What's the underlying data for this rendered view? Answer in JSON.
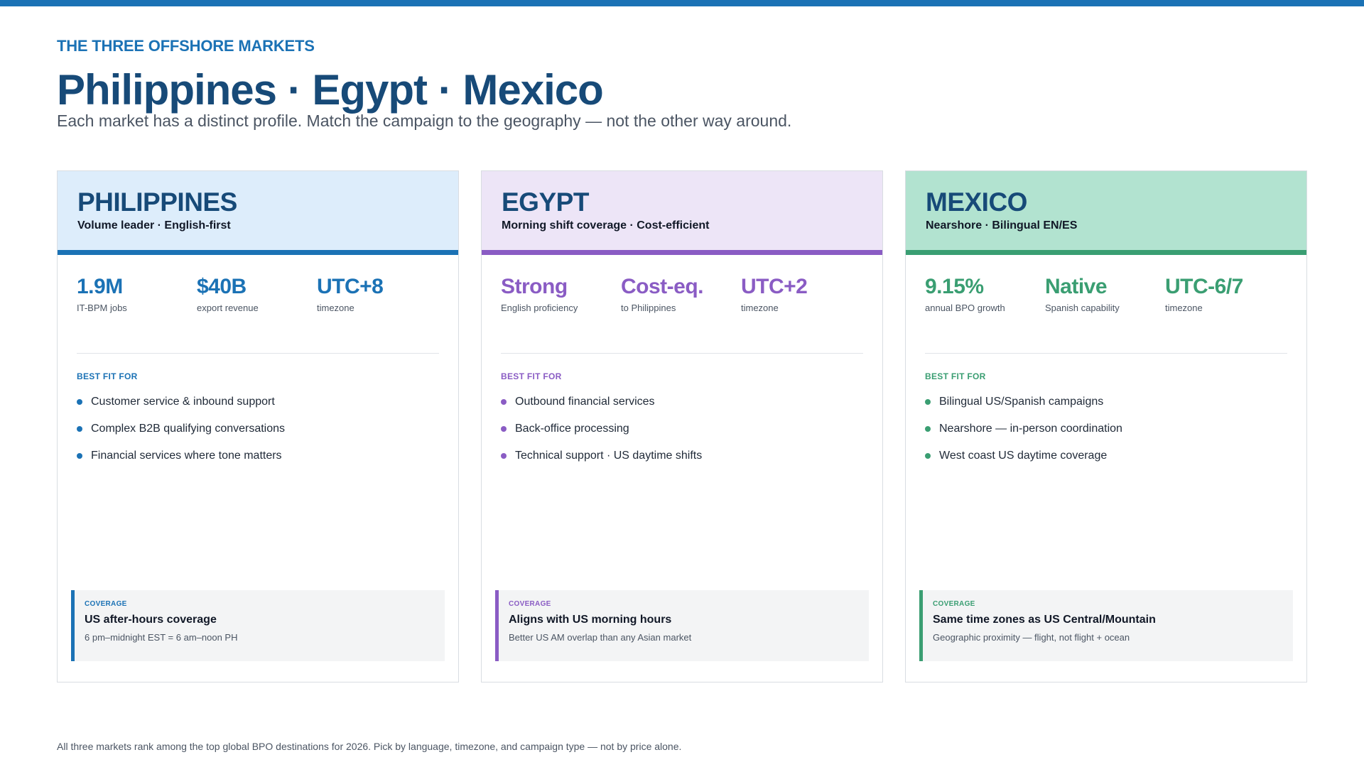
{
  "eyebrow": "THE THREE OFFSHORE MARKETS",
  "title": "Philippines · Egypt · Mexico",
  "subtitle": "Each market has a distinct profile. Match the campaign to the geography — not the other way around.",
  "accent_color": "#1b72b5",
  "markets": [
    {
      "name": "PHILIPPINES",
      "tagline": "Volume leader · English-first",
      "head_bg": "#ddedfb",
      "accent": "#1b72b5",
      "stats": [
        {
          "value": "1.9M",
          "label": "IT-BPM jobs"
        },
        {
          "value": "$40B",
          "label": "export revenue"
        },
        {
          "value": "UTC+8",
          "label": "timezone"
        }
      ],
      "best_fit_title": "BEST FIT FOR",
      "best_fit": [
        "Customer service & inbound support",
        "Complex B2B qualifying conversations",
        "Financial services where tone matters"
      ],
      "coverage": {
        "label": "COVERAGE",
        "title": "US after-hours coverage",
        "note": "6 pm–midnight EST = 6 am–noon PH"
      }
    },
    {
      "name": "EGYPT",
      "tagline": "Morning shift coverage · Cost-efficient",
      "head_bg": "#ede5f7",
      "accent": "#8a5cc4",
      "stats": [
        {
          "value": "Strong",
          "label": "English proficiency"
        },
        {
          "value": "Cost-eq.",
          "label": "to Philippines"
        },
        {
          "value": "UTC+2",
          "label": "timezone"
        }
      ],
      "best_fit_title": "BEST FIT FOR",
      "best_fit": [
        "Outbound financial services",
        "Back-office processing",
        "Technical support · US daytime shifts"
      ],
      "coverage": {
        "label": "COVERAGE",
        "title": "Aligns with US morning hours",
        "note": "Better US AM overlap than any Asian market"
      }
    },
    {
      "name": "MEXICO",
      "tagline": "Nearshore · Bilingual EN/ES",
      "head_bg": "#b2e3d0",
      "accent": "#3a9e72",
      "stats": [
        {
          "value": "9.15%",
          "label": "annual BPO growth"
        },
        {
          "value": "Native",
          "label": "Spanish capability"
        },
        {
          "value": "UTC-6/7",
          "label": "timezone"
        }
      ],
      "best_fit_title": "BEST FIT FOR",
      "best_fit": [
        "Bilingual US/Spanish campaigns",
        "Nearshore — in-person coordination",
        "West coast US daytime coverage"
      ],
      "coverage": {
        "label": "COVERAGE",
        "title": "Same time zones as US Central/Mountain",
        "note": "Geographic proximity — flight, not flight + ocean"
      }
    }
  ],
  "footer": "All three markets rank among the top global BPO destinations for 2026. Pick by language, timezone, and campaign type — not by price alone."
}
